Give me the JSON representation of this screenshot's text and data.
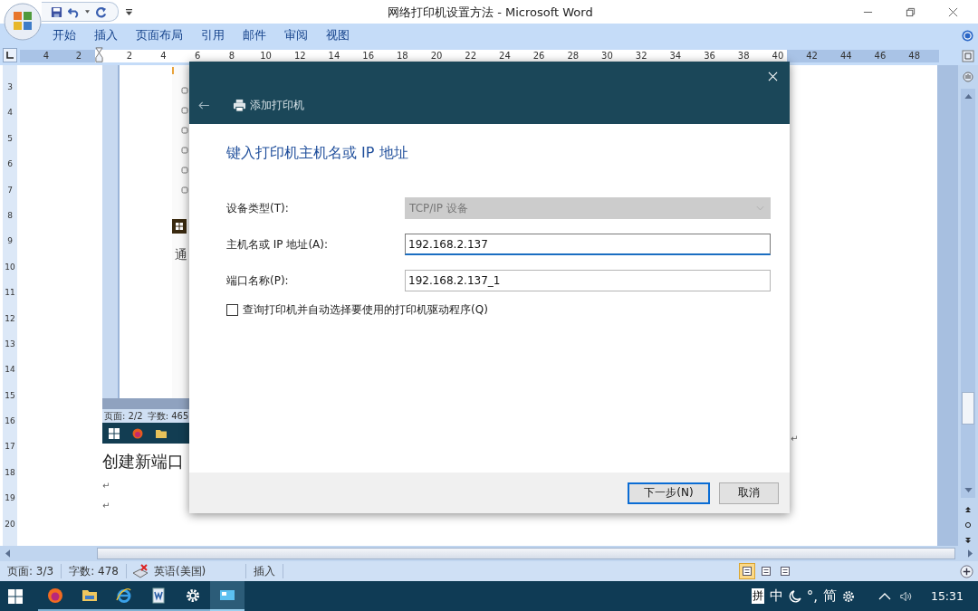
{
  "window": {
    "title": "网络打印机设置方法 - Microsoft Word"
  },
  "ribbon_tabs": [
    "开始",
    "插入",
    "页面布局",
    "引用",
    "邮件",
    "审阅",
    "视图"
  ],
  "ruler": {
    "left_numbers": [
      "4",
      "2"
    ],
    "numbers": [
      "2",
      "4",
      "6",
      "8",
      "10",
      "12",
      "14",
      "16",
      "18",
      "20",
      "22",
      "24",
      "26",
      "28",
      "30",
      "32",
      "34",
      "36",
      "38",
      "40",
      "42",
      "44",
      "46",
      "48"
    ]
  },
  "vertical_ruler": [
    "3",
    "4",
    "5",
    "6",
    "7",
    "8",
    "9",
    "10",
    "11",
    "12",
    "13",
    "14",
    "15",
    "16",
    "17",
    "18",
    "19",
    "20"
  ],
  "embedded_screenshot": {
    "text_fragment": "通",
    "status_page": "页面: 2/2",
    "status_words": "字数: 465"
  },
  "document": {
    "image_mark": "↵",
    "paragraphs": [
      {
        "kind": "heading",
        "text": "创建新端口"
      },
      {
        "kind": "mark",
        "text": "↵"
      },
      {
        "kind": "mark",
        "text": "↵"
      }
    ]
  },
  "dialog": {
    "title": "添加打印机",
    "heading": "键入打印机主机名或 IP 地址",
    "fields": [
      {
        "label": "设备类型(T):",
        "value": "TCP/IP 设备",
        "kind": "dropdown",
        "disabled": true
      },
      {
        "label": "主机名或 IP 地址(A):",
        "value": "192.168.2.137",
        "kind": "text",
        "disabled": false,
        "focused": true
      },
      {
        "label": "端口名称(P):",
        "value": "192.168.2.137_1",
        "kind": "text",
        "disabled": false,
        "focused": false
      }
    ],
    "checkbox": {
      "label": "查询打印机并自动选择要使用的打印机驱动程序(Q)",
      "checked": false
    },
    "buttons": [
      {
        "label": "下一步(N)",
        "default": true
      },
      {
        "label": "取消",
        "default": false
      }
    ]
  },
  "status_bar": {
    "page": "页面: 3/3",
    "words": "字数: 478",
    "language": "英语(美国)",
    "mode": "插入",
    "views": [
      {
        "selected": true
      },
      {
        "selected": false
      },
      {
        "selected": false
      }
    ]
  },
  "taskbar": {
    "apps": [
      {
        "kind": "firefox",
        "selected": false
      },
      {
        "kind": "folder",
        "selected": false
      },
      {
        "kind": "ie",
        "selected": false
      },
      {
        "kind": "word",
        "selected": false
      },
      {
        "kind": "settings",
        "selected": false
      },
      {
        "kind": "remote",
        "selected": true
      }
    ],
    "ime": "拼",
    "input_mode": "中",
    "punctuation": "°,",
    "script": "简",
    "time": "15:31"
  }
}
